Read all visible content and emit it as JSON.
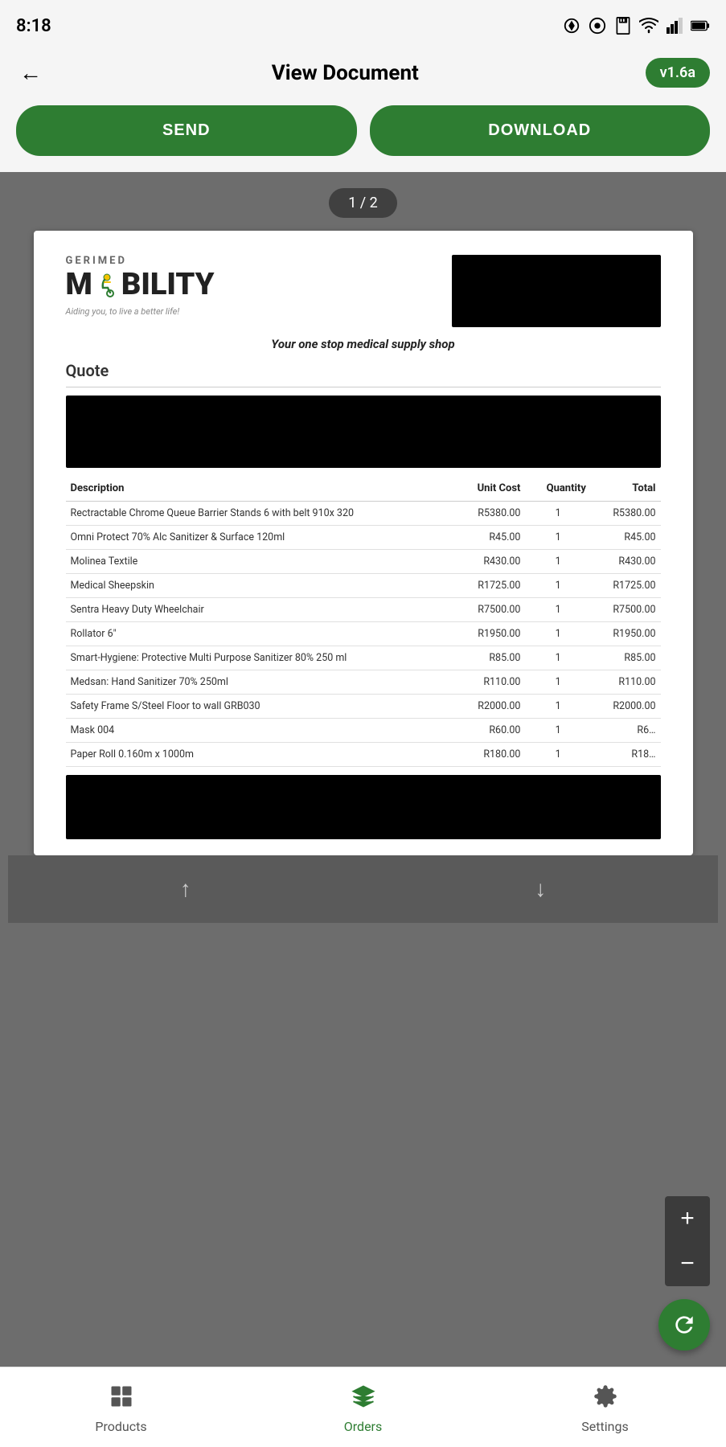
{
  "statusBar": {
    "time": "8:18",
    "icons": [
      "aviate",
      "lastpass",
      "save"
    ]
  },
  "header": {
    "backLabel": "←",
    "title": "View Document",
    "version": "v1.6a"
  },
  "buttons": {
    "send": "SEND",
    "download": "DOWNLOAD"
  },
  "pageIndicator": "1 / 2",
  "document": {
    "logoMain": "M",
    "logoBility": "BILITY",
    "logoGerimed": "GERIMED",
    "logoTagline": "Aiding you, to live a better life!",
    "subtitle": "Your one stop medical supply shop",
    "quoteTitle": "Quote",
    "table": {
      "headers": [
        "Description",
        "Unit Cost",
        "Quantity",
        "Total"
      ],
      "rows": [
        [
          "Rectractable Chrome Queue Barrier Stands 6 with belt 910x 320",
          "R5380.00",
          "1",
          "R5380.00"
        ],
        [
          "Omni Protect 70% Alc Sanitizer & Surface 120ml",
          "R45.00",
          "1",
          "R45.00"
        ],
        [
          "Molinea Textile",
          "R430.00",
          "1",
          "R430.00"
        ],
        [
          "Medical Sheepskin",
          "R1725.00",
          "1",
          "R1725.00"
        ],
        [
          "Sentra Heavy Duty Wheelchair",
          "R7500.00",
          "1",
          "R7500.00"
        ],
        [
          "Rollator 6\"",
          "R1950.00",
          "1",
          "R1950.00"
        ],
        [
          "Smart-Hygiene: Protective Multi Purpose Sanitizer 80% 250 ml",
          "R85.00",
          "1",
          "R85.00"
        ],
        [
          "Medsan: Hand Sanitizer 70% 250ml",
          "R110.00",
          "1",
          "R110.00"
        ],
        [
          "Safety Frame S/Steel Floor to wall GRB030",
          "R2000.00",
          "1",
          "R2000.00"
        ],
        [
          "Mask 004",
          "R60.00",
          "1",
          "R6…"
        ],
        [
          "Paper Roll 0.160m x 1000m",
          "R180.00",
          "1",
          "R18…"
        ]
      ]
    }
  },
  "navigation": {
    "upArrow": "↑",
    "downArrow": "↓"
  },
  "bottomNav": {
    "items": [
      {
        "label": "Products",
        "icon": "grid",
        "active": false
      },
      {
        "label": "Orders",
        "icon": "box",
        "active": true
      },
      {
        "label": "Settings",
        "icon": "gear",
        "active": false
      }
    ]
  },
  "colors": {
    "primary": "#2e7d32",
    "dark": "#222",
    "gray": "#6d6d6d"
  }
}
